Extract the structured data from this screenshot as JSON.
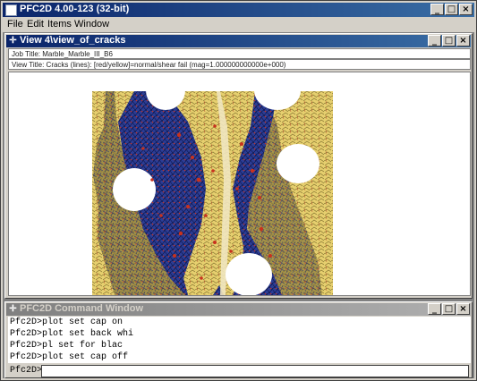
{
  "app": {
    "title": "PFC2D 4.00-123 (32-bit)"
  },
  "window_buttons": {
    "minimize": "_",
    "maximize": "□",
    "close": "×"
  },
  "menu": [
    "File",
    "Edit",
    "Items",
    "Window"
  ],
  "view_window": {
    "title": "View 4\\view_of_cracks",
    "job_title": "Job Title: Marble_Marble_III_B6",
    "view_title": "View Title: Cracks (lines): [red/yellow]=normal/shear fail (mag=1.000000000000e+000)"
  },
  "command_window": {
    "title": "PFC2D Command Window",
    "lines": [
      "Pfc2D>plot set cap on",
      "Pfc2D>plot set back whi",
      "Pfc2D>pl set for blac",
      "Pfc2D>plot set cap off"
    ],
    "prompt": "Pfc2D>",
    "input_value": ""
  },
  "colors": {
    "title_active": "#0a246a",
    "plot_background": "#fff",
    "specimen_yellow": "#e8d27a",
    "force_blue": "#2d3f9a",
    "crack_red": "#c8321e"
  }
}
